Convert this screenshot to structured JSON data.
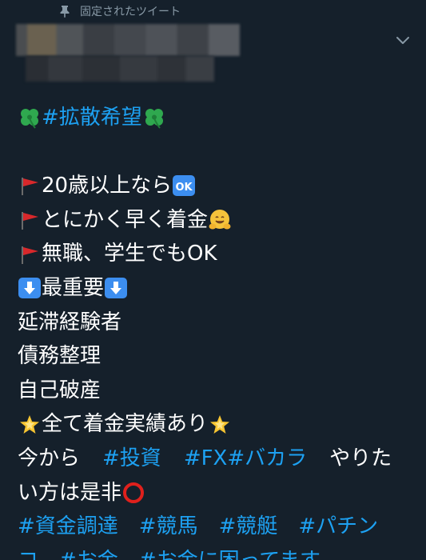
{
  "pinned": {
    "label": "固定されたツイート"
  },
  "tweet": {
    "title_tag": "#拡散希望",
    "lines": [
      {
        "text": "20歳以上なら"
      },
      {
        "text": "とにかく早く着金"
      },
      {
        "text": "無職、学生でもOK"
      },
      {
        "text": "最重要"
      },
      {
        "text": "延滞経験者"
      },
      {
        "text": "債務整理"
      },
      {
        "text": "自己破産"
      },
      {
        "text": "全て着金実績あり"
      }
    ],
    "line9": {
      "prefix": "今から",
      "tag1": "#投資",
      "tag2": "#FX",
      "tag3": "#バカラ",
      "suffix": "やりた"
    },
    "line10": {
      "text": "い方は是非"
    },
    "line11": {
      "tag1": "#資金調達",
      "tag2": "#競馬",
      "tag3": "#競艇",
      "tag4": "#パチン"
    },
    "line12": {
      "prefix": "コ",
      "tag1": "#お金",
      "tag2": "#お金に困ってます"
    },
    "ok_badge": "OK"
  },
  "colors": {
    "background": "#15202b",
    "text": "#ffffff",
    "hashtag": "#1da1f2",
    "muted": "#8899a6"
  },
  "icons": {
    "pin": "pin-icon",
    "caret": "chevron-down-icon",
    "clover": "four-leaf-clover-emoji",
    "flag": "red-triangular-flag-emoji",
    "ok": "ok-button-emoji",
    "hug": "hugging-face-emoji",
    "down": "down-arrow-emoji",
    "star": "glowing-star-emoji",
    "circle": "red-hollow-circle-emoji"
  }
}
